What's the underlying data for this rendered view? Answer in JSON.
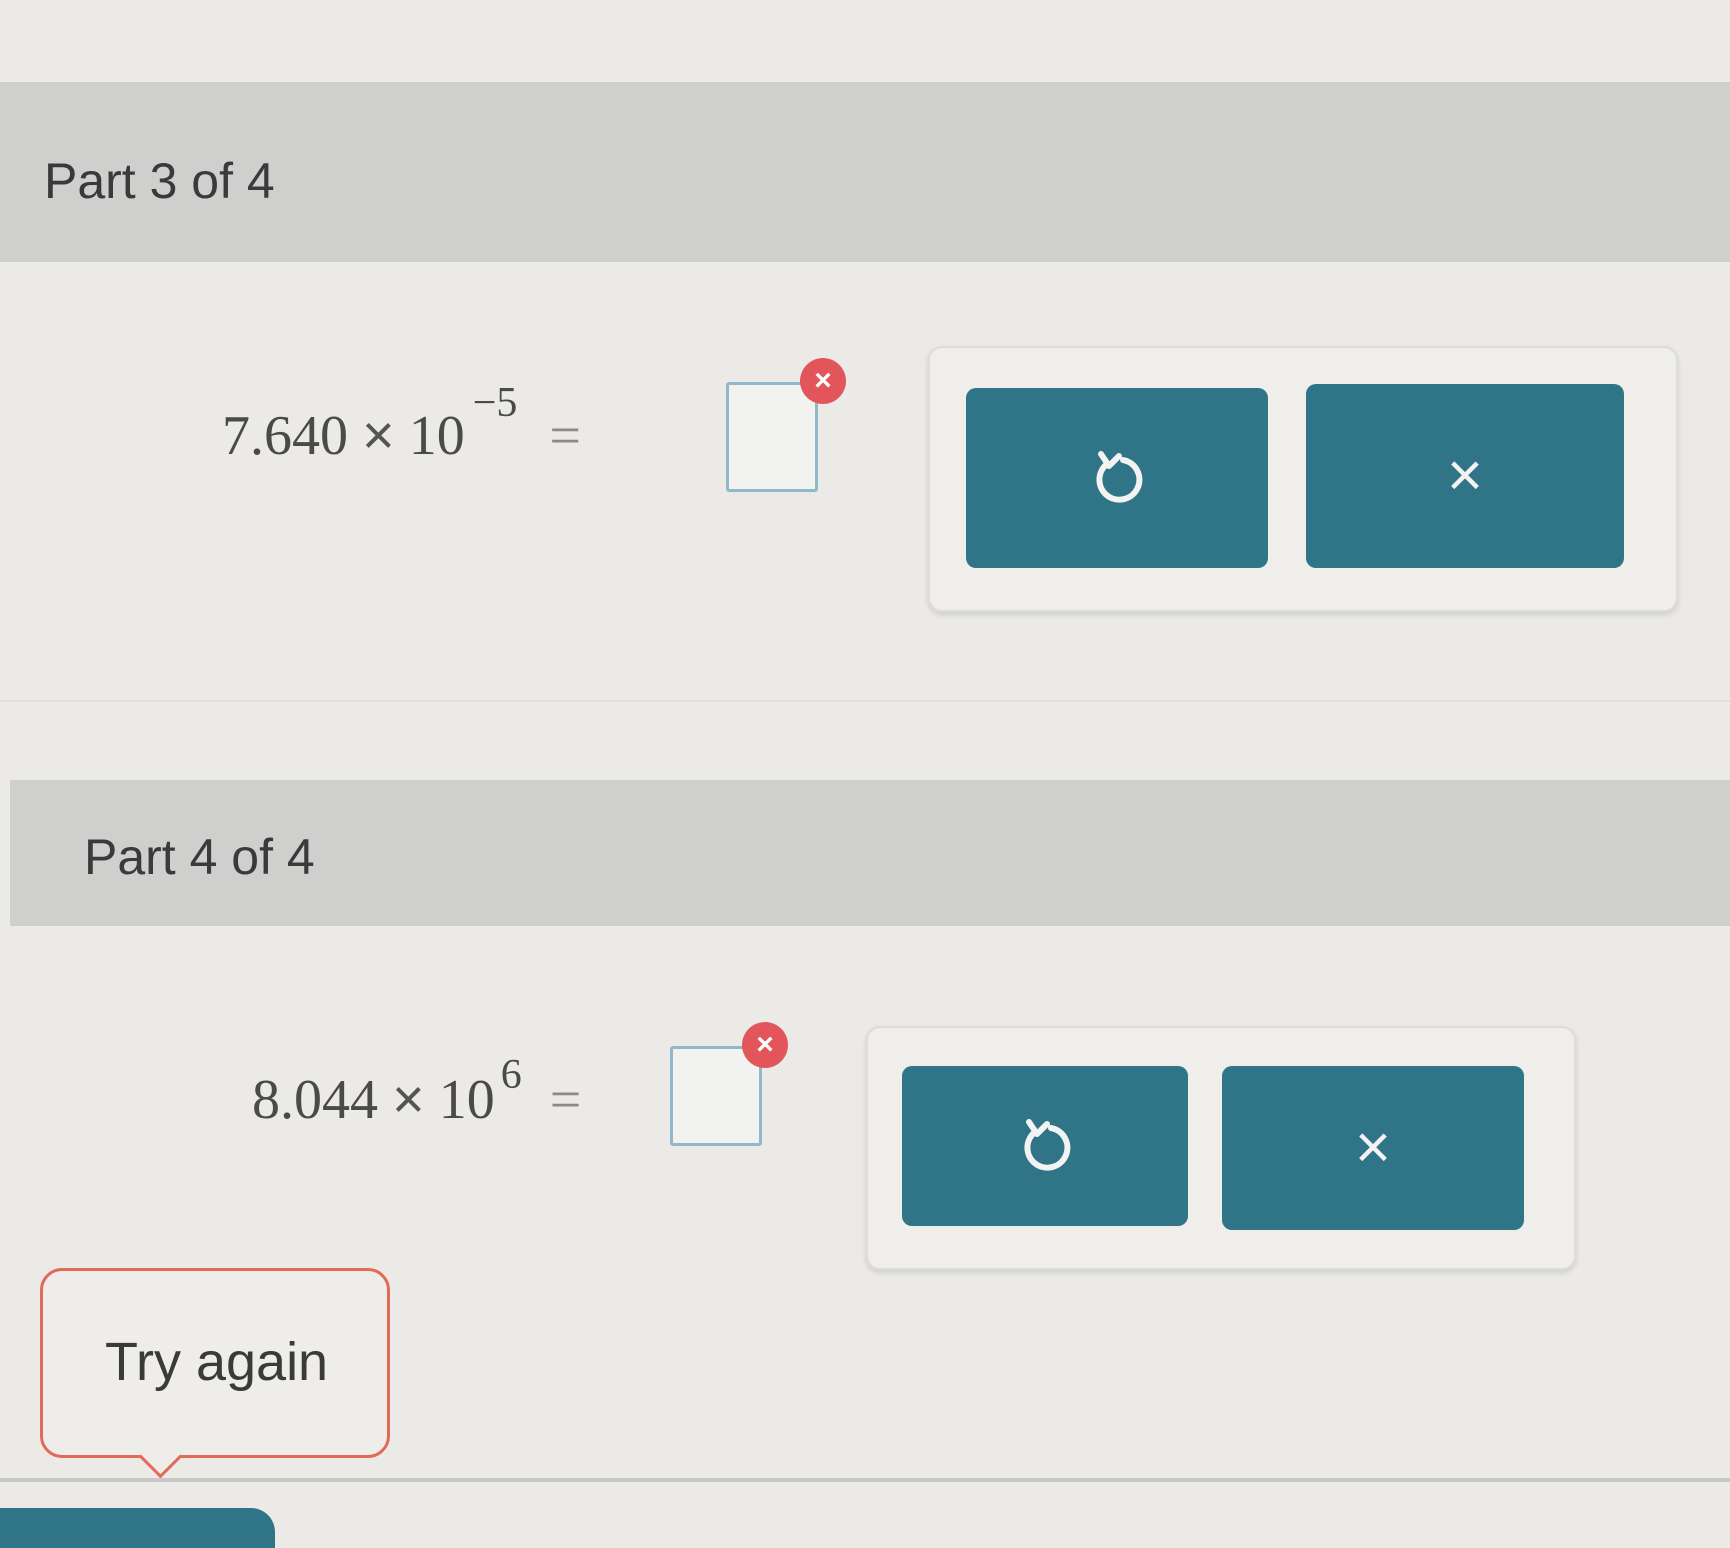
{
  "part3": {
    "header": "Part 3 of 4",
    "coefficient": "7.640",
    "times": "×",
    "base": "10",
    "exponent": "−5",
    "equals": "=",
    "answer_value": "",
    "error_icon": "error-x-icon",
    "buttons": {
      "undo_icon": "undo-icon",
      "clear_icon": "close-icon",
      "clear_glyph": "×"
    }
  },
  "part4": {
    "header": "Part 4 of 4",
    "coefficient": "8.044",
    "times": "×",
    "base": "10",
    "exponent": "6",
    "equals": "=",
    "answer_value": "",
    "error_icon": "error-x-icon",
    "buttons": {
      "undo_icon": "undo-icon",
      "clear_icon": "close-icon",
      "clear_glyph": "×"
    }
  },
  "feedback": {
    "try_again": "Try again"
  },
  "colors": {
    "button": "#2f7487",
    "error": "#e2555a",
    "feedback_border": "#e26b57",
    "header_bg": "#cfd0ce"
  }
}
